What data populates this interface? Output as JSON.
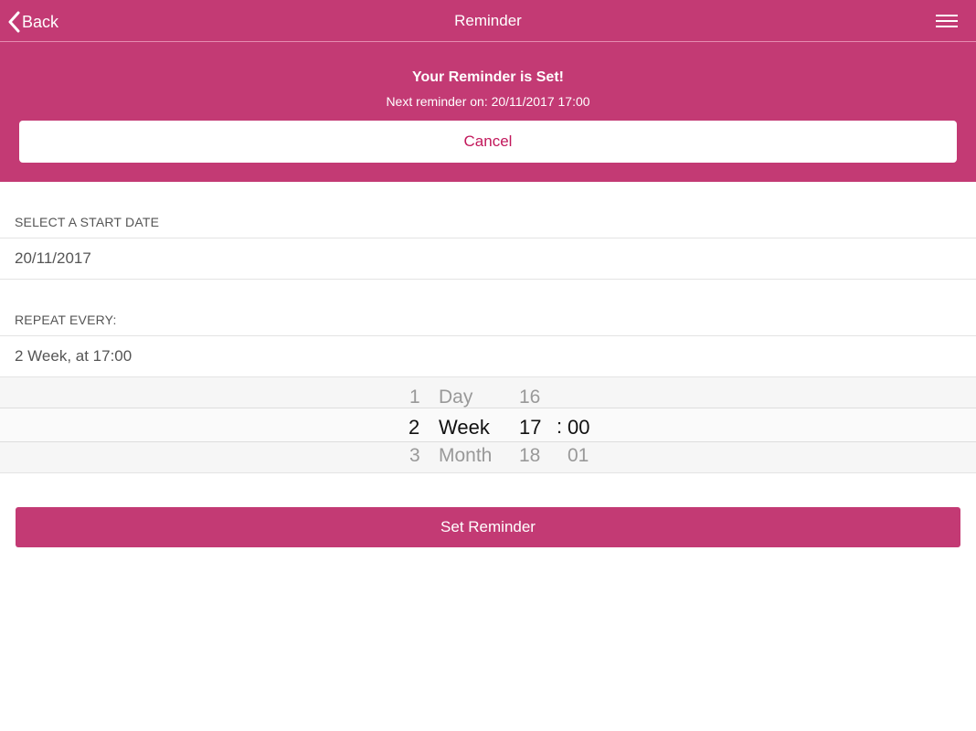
{
  "nav": {
    "back_label": "Back",
    "title": "Reminder"
  },
  "banner": {
    "title": "Your Reminder is Set!",
    "subtitle": "Next reminder on: 20/11/2017 17:00",
    "cancel_label": "Cancel"
  },
  "start_date": {
    "label": "SELECT A START DATE",
    "value": "20/11/2017"
  },
  "repeat": {
    "label": "REPEAT EVERY:",
    "value": "2 Week, at 17:00"
  },
  "picker": {
    "numbers": [
      "1",
      "2",
      "3"
    ],
    "units": [
      "Day",
      "Week",
      "Month"
    ],
    "hours": [
      "16",
      "17",
      "18"
    ],
    "separator": ":",
    "minutes": [
      "00",
      "01"
    ]
  },
  "set_label": "Set Reminder",
  "colors": {
    "brand": "#c33a74",
    "cancel_text": "#c2185b"
  }
}
